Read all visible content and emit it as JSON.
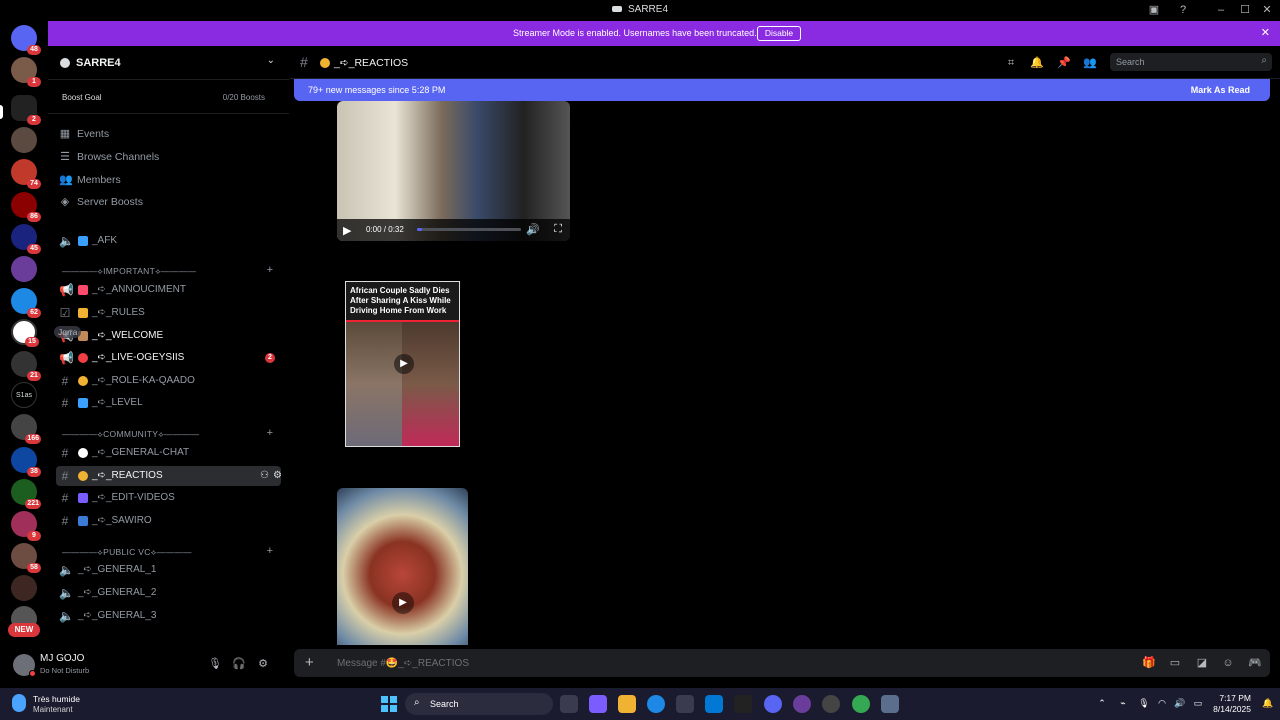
{
  "window": {
    "title": "SARRE4"
  },
  "streamer_banner": {
    "message": "Streamer Mode is enabled. Usernames have been truncated.",
    "button": "Disable"
  },
  "server_rail": {
    "badges": [
      "48",
      "1",
      "2",
      "74",
      "86",
      "45",
      "",
      "62",
      "15",
      "21",
      "",
      "166",
      "38",
      "221",
      "9",
      "58",
      ""
    ],
    "text_server_label": "S1as",
    "new_label": "NEW"
  },
  "guild": {
    "name": "SARRE4",
    "boost_goal_label": "Boost Goal",
    "boost_count": "0/20 Boosts"
  },
  "nav": [
    {
      "label": "Events",
      "icon": "calendar-icon"
    },
    {
      "label": "Browse Channels",
      "icon": "browse-icon"
    },
    {
      "label": "Members",
      "icon": "members-icon"
    },
    {
      "label": "Server Boosts",
      "icon": "boost-icon"
    }
  ],
  "afk_channel": {
    "label": "_AFK"
  },
  "categories": {
    "important": "————⟡IMPORTANT⟡————",
    "community": "————⟡COMMUNITY⟡————",
    "public_vc": "————⟡PUBLIC VC⟡————"
  },
  "channels_important": [
    {
      "label": "_➪_ANNOUCIMENT",
      "emoji_color": "#ff4b6b",
      "type": "announcement"
    },
    {
      "label": "_➪_RULES",
      "emoji_color": "#f0b232",
      "type": "rules"
    },
    {
      "label": "_➪_WELCOME",
      "emoji_color": "#c08a5a",
      "type": "announcement"
    },
    {
      "label": "_➪_LIVE-OGEYSIIS",
      "emoji_color": "#f23f43",
      "type": "announcement",
      "mention": "2"
    },
    {
      "label": "_➪_ROLE-KA-QAADO",
      "emoji_color": "#f0b232",
      "type": "text"
    },
    {
      "label": "_➪_LEVEL",
      "emoji_color": "#3aa0ff",
      "type": "text"
    }
  ],
  "channels_community": [
    {
      "label": "_➪_GENERAL-CHAT",
      "emoji_color": "#ffffff"
    },
    {
      "label": "_➪_REACTIOS",
      "emoji_color": "#f0b232"
    },
    {
      "label": "_➪_EDIT-VIDEOS",
      "emoji_color": "#7b5cff"
    },
    {
      "label": "_➪_SAWIRO",
      "emoji_color": "#3a7bd5"
    }
  ],
  "channels_voice": [
    {
      "label": "_➪_GENERAL_1"
    },
    {
      "label": "_➪_GENERAL_2"
    },
    {
      "label": "_➪_GENERAL_3"
    }
  ],
  "drag_overlay": "Jqrra",
  "user": {
    "name": "MJ GOJO",
    "status": "Do Not Disturb"
  },
  "chat": {
    "channel_name": "_➪_REACTIOS",
    "search_placeholder": "Search",
    "new_messages": "79+ new messages since 5:28 PM",
    "mark_as_read": "Mark As Read",
    "composer_placeholder": "Message #🤩_➪_REACTIOS"
  },
  "video1": {
    "time": "0:00 / 0:32",
    "progress": 0.05
  },
  "video2": {
    "caption": "African Couple Sadly Dies After Sharing A Kiss While Driving Home From Work"
  },
  "taskbar": {
    "weather_line1": "Très humide",
    "weather_line2": "Maintenant",
    "search": "Search",
    "time": "7:17 PM",
    "date": "8/14/2025"
  }
}
